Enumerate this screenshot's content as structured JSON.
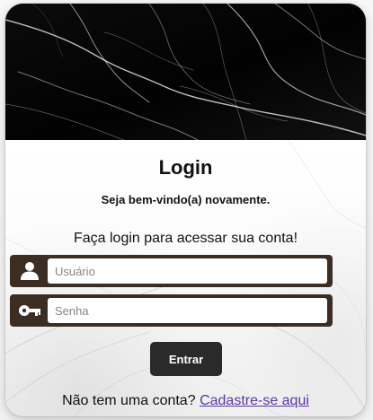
{
  "login": {
    "title": "Login",
    "subtitle": "Seja bem-vindo(a) novamente.",
    "instruction": "Faça login para acessar sua conta!",
    "username": {
      "placeholder": "Usuário",
      "icon": "user-icon"
    },
    "password": {
      "placeholder": "Senha",
      "icon": "key-icon"
    },
    "submit_label": "Entrar",
    "footer_prompt": "Não tem uma conta?",
    "signup_link": "Cadastre-se aqui"
  },
  "theme": {
    "header_bg": "#050505",
    "field_frame": "#3b2d24",
    "button_bg": "#2a2a2a",
    "link_color": "#5b35a6"
  }
}
